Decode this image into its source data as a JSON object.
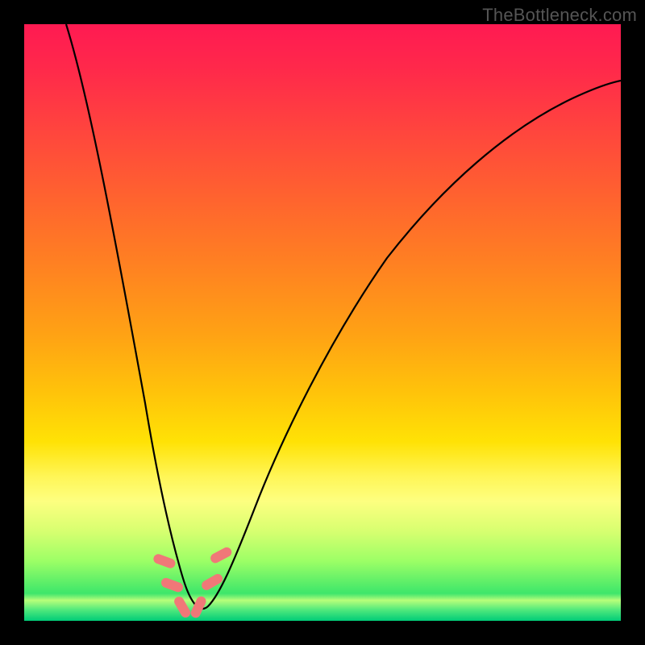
{
  "watermark": "TheBottleneck.com",
  "chart_data": {
    "type": "line",
    "title": "",
    "xlabel": "",
    "ylabel": "",
    "xlim": [
      0,
      100
    ],
    "ylim": [
      0,
      100
    ],
    "grid": false,
    "legend": false,
    "series": [
      {
        "name": "bottleneck-curve",
        "x": [
          7,
          10,
          13,
          16,
          19,
          21,
          23,
          25,
          26.5,
          28,
          30,
          33,
          38,
          45,
          55,
          65,
          75,
          85,
          95,
          100
        ],
        "y": [
          100,
          85,
          70,
          55,
          40,
          28,
          18,
          10,
          4,
          2,
          4,
          10,
          22,
          38,
          55,
          67,
          76,
          82,
          86,
          88
        ]
      }
    ],
    "markers": [
      {
        "x": 23.5,
        "y": 10,
        "angle": -70
      },
      {
        "x": 24.8,
        "y": 6,
        "angle": -70
      },
      {
        "x": 26.5,
        "y": 2.3,
        "angle": -30
      },
      {
        "x": 29.2,
        "y": 2.3,
        "angle": 25
      },
      {
        "x": 31.5,
        "y": 6.5,
        "angle": 60
      },
      {
        "x": 33.0,
        "y": 11,
        "angle": 62
      }
    ],
    "marker_color": "#f07878",
    "curve_color": "#000000",
    "background": "rainbow-gradient"
  }
}
